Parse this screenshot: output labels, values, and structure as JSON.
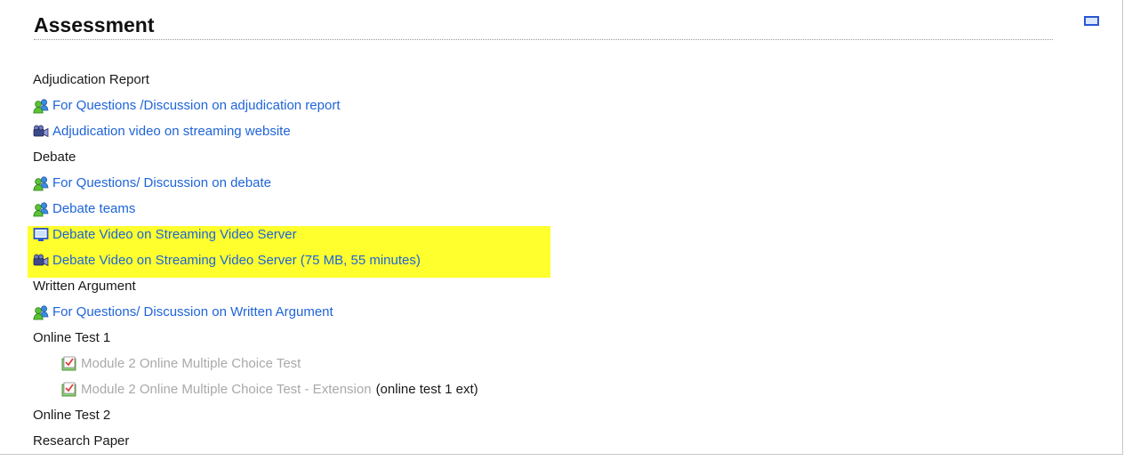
{
  "section": {
    "title": "Assessment",
    "toggle_icon": "window-toggle-icon"
  },
  "colors": {
    "link": "#1e64d8",
    "dimmed_link": "#a9a9a9",
    "highlight": "#ffff2e",
    "text": "#1a1a1a"
  },
  "items": [
    {
      "kind": "label",
      "text": "Adjudication Report"
    },
    {
      "kind": "link",
      "icon": "forum-users-icon",
      "text": "For Questions /Discussion on adjudication report"
    },
    {
      "kind": "link",
      "icon": "video-camera-icon",
      "text": "Adjudication video on streaming website"
    },
    {
      "kind": "label",
      "text": "Debate"
    },
    {
      "kind": "link",
      "icon": "forum-users-icon",
      "text": "For Questions/ Discussion on debate"
    },
    {
      "kind": "link",
      "icon": "forum-users-icon",
      "text": "Debate teams"
    },
    {
      "kind": "link",
      "icon": "monitor-icon",
      "text": "Debate Video on Streaming Video Server",
      "highlighted": true
    },
    {
      "kind": "link",
      "icon": "video-camera-icon",
      "text": "Debate Video on Streaming Video Server  (75 MB, 55 minutes)",
      "highlighted": true
    },
    {
      "kind": "label",
      "text": "Written Argument"
    },
    {
      "kind": "link",
      "icon": "forum-users-icon",
      "text": "For Questions/ Discussion on Written Argument"
    },
    {
      "kind": "label",
      "text": "Online Test 1"
    },
    {
      "kind": "link",
      "icon": "quiz-icon",
      "text": "Module 2 Online Multiple Choice Test",
      "dimmed": true,
      "indented": true
    },
    {
      "kind": "link",
      "icon": "quiz-icon",
      "text": "Module 2 Online Multiple Choice Test - Extension",
      "suffix": "(online test 1 ext)",
      "dimmed": true,
      "indented": true
    },
    {
      "kind": "label",
      "text": "Online Test 2"
    },
    {
      "kind": "label",
      "text": "Research Paper"
    }
  ]
}
